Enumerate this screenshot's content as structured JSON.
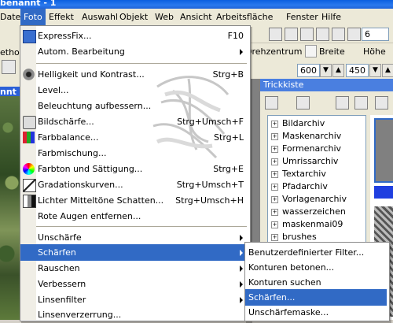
{
  "titlebar": {
    "title": "benannt - 1"
  },
  "menubar": [
    {
      "label": "Datei"
    },
    {
      "label": "Foto"
    },
    {
      "label": "Effekt"
    },
    {
      "label": "Auswahl"
    },
    {
      "label": "Objekt"
    },
    {
      "label": "Web"
    },
    {
      "label": "Ansicht"
    },
    {
      "label": "Arbeitsfläche"
    },
    {
      "label": "Fenster"
    },
    {
      "label": "Hilfe"
    }
  ],
  "left_strip": {
    "label_top": "ethod",
    "window_title": "nnt -"
  },
  "options_bar": {
    "rotation_label": "Drehzentrum",
    "width_label": "Breite",
    "height_label": "Höhe",
    "width_value": "600",
    "height_value": "450",
    "partial_value": "6"
  },
  "trickkiste": {
    "title": "Trickkiste",
    "tree": [
      "Bildarchiv",
      "Maskenarchiv",
      "Formenarchiv",
      "Umrissarchiv",
      "Textarchiv",
      "Pfadarchiv",
      "Vorlagenarchiv",
      "wasserzeichen",
      "maskenmai09",
      "brushes"
    ]
  },
  "foto_menu": [
    {
      "label": "ExpressFix...",
      "shortcut": "F10",
      "icon": "expressfix-icon"
    },
    {
      "label": "Autom. Bearbeitung",
      "submenu": true
    },
    {
      "label": "Helligkeit und Kontrast...",
      "shortcut": "Strg+B",
      "icon": "brightness-icon"
    },
    {
      "label": "Level..."
    },
    {
      "label": "Beleuchtung aufbessern..."
    },
    {
      "label": "Bildschärfe...",
      "shortcut": "Strg+Umsch+F",
      "icon": "sharpness-icon"
    },
    {
      "label": "Farbbalance...",
      "shortcut": "Strg+L",
      "icon": "colorbalance-icon"
    },
    {
      "label": "Farbmischung..."
    },
    {
      "label": "Farbton und Sättigung...",
      "shortcut": "Strg+E",
      "icon": "hue-icon"
    },
    {
      "label": "Gradationskurven...",
      "shortcut": "Strg+Umsch+T",
      "icon": "curves-icon"
    },
    {
      "label": "Lichter Mitteltöne Schatten...",
      "shortcut": "Strg+Umsch+H",
      "icon": "tones-icon"
    },
    {
      "label": "Rote Augen entfernen..."
    },
    {
      "label": "Unschärfe",
      "submenu": true
    },
    {
      "label": "Schärfen",
      "submenu": true
    },
    {
      "label": "Rauschen",
      "submenu": true
    },
    {
      "label": "Verbessern",
      "submenu": true
    },
    {
      "label": "Linsenfilter",
      "submenu": true
    },
    {
      "label": "Linsenverzerrung..."
    }
  ],
  "schaerfen_submenu": [
    {
      "label": "Benutzerdefinierter Filter..."
    },
    {
      "label": "Konturen betonen..."
    },
    {
      "label": "Konturen suchen"
    },
    {
      "label": "Schärfen..."
    },
    {
      "label": "Unschärfemaske..."
    }
  ],
  "colors": {
    "highlight": "#316ac5",
    "menubar": "#ece9d8",
    "titlebar": "#0b5fe0"
  }
}
